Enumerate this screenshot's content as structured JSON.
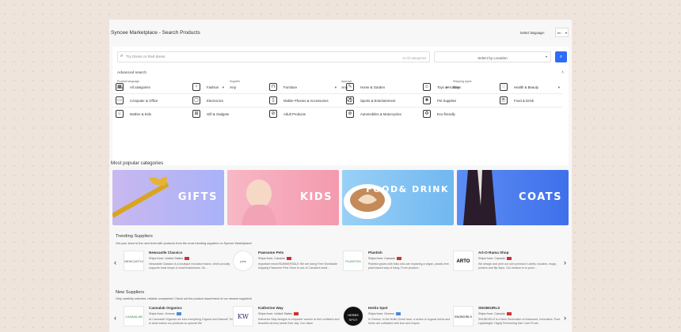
{
  "header": {
    "title": "Syncee Marketplace - Search Products",
    "language_label": "Select language:",
    "language_value": "en"
  },
  "search": {
    "placeholder": "Try Dress or Red dress",
    "categories_label": "In All categories",
    "location_label": "Select by Location"
  },
  "advanced": {
    "title": "Advanced search",
    "filters": [
      {
        "label": "Product language",
        "value": "Any"
      },
      {
        "label": "Supplier",
        "value": "Any"
      },
      {
        "label": "Approve",
        "value": "Any"
      },
      {
        "label": "Shipping types",
        "value": "Any"
      }
    ]
  },
  "categories": [
    [
      "All categories",
      "Fashion",
      "Furniture",
      "Home & Garden",
      "Toys & Hobbies",
      "Health & Beauty"
    ],
    [
      "Computer & Office",
      "Electronics",
      "Mobile Phones & Accessories",
      "Sports & Entertainment",
      "Pet Supplies",
      "Food & Drink"
    ],
    [
      "Mother & Kids",
      "Gift & Gadgets",
      "Adult Products",
      "Automobiles & Motorcycles",
      "Eco-friendly"
    ]
  ],
  "popular": {
    "title": "Most popular categories",
    "banners": [
      {
        "label": "GIFTS",
        "color": "#b9b6f6"
      },
      {
        "label": "KIDS",
        "color": "#f4a6b8"
      },
      {
        "label": "FOOD& DRINK",
        "color": "#86c6f4"
      },
      {
        "label": "COATS",
        "color": "#4a7ff0"
      }
    ]
  },
  "trending": {
    "title": "Trending Suppliers",
    "subtitle": "Get your store to the next level with products from the most trending suppliers on Syncee Marketplace!",
    "suppliers": [
      {
        "name": "Newcastle Classics",
        "from": "Ships from: United States",
        "desc": "Newcastle Classics is a boutique exclusive brand, which proudly supports local shops & small businesses. Ou...",
        "logo": "NEWCASTLE"
      },
      {
        "name": "Pawsome Pets",
        "from": "Ships from: Canada",
        "desc": "Important news!!SUMMERSALE We are doing Free Worldwide shipping Pawsome Pets Store is one of Canada's leadi...",
        "logo": "pets"
      },
      {
        "name": "Plantish",
        "from": "Ships from: Canada",
        "desc": "Plantish grows with folks who are exploring a vegan, plastic-free, plant-based way of living. From product...",
        "logo": "PLANTISH"
      },
      {
        "name": "Art-O-Rama Shop",
        "from": "Ships from: Canada",
        "desc": "We design and print our own premium t-shirts, hoodies, mugs, posters and flip-flops. Our mission is to provi...",
        "logo": "ARTO"
      }
    ]
  },
  "new_suppliers": {
    "title": "New Suppliers",
    "subtitle": "Only carefully selected, reliable companies! Check out the product assortment of our newest suppliers!",
    "suppliers": [
      {
        "name": "Cannalab Organics",
        "from": "Ships from: Greece",
        "desc": "At Cannalab Organics we love everything Organic and Natural! This is what makes our products so special We",
        "logo": "CANNALAB"
      },
      {
        "name": "Katherine Way",
        "from": "Ships from: United States",
        "desc": "Katherine Way designs to empower women to feel confident and beautiful as they tackle their day. Our vision",
        "logo": "KW"
      },
      {
        "name": "Herbs Spot",
        "from": "Ships from: Greece",
        "desc": "In Greece, in the fertile Greek land, a series of organic herbs and herbs are cultivated with love and respec",
        "logo": "HERBS SPOT"
      },
      {
        "name": "SNOBGIRLS",
        "from": "Ships from: Canada",
        "desc": "SNOBGIRLS is a New Generation of Advanced, Innovative, Pure, Lightweight, Highly Performing Hair Care Produ",
        "logo": "SNOBGIRLS"
      }
    ]
  }
}
